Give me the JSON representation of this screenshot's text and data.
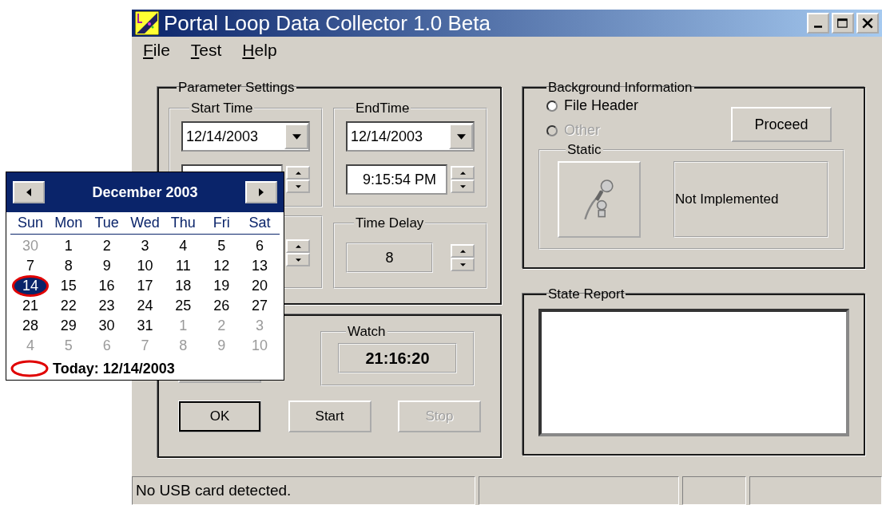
{
  "window": {
    "title": "Portal Loop Data Collector 1.0 Beta"
  },
  "menu": [
    "File",
    "Test",
    "Help"
  ],
  "parameter_settings": {
    "title": "Parameter Settings",
    "start_time": {
      "title": "Start Time",
      "date": "12/14/2003"
    },
    "end_time": {
      "title": "EndTime",
      "date": "12/14/2003",
      "time": "9:15:54 PM"
    },
    "time_delay": {
      "title": "Time Delay",
      "value": "8"
    }
  },
  "watch": {
    "title": "Watch",
    "time": "21:16:20"
  },
  "buttons": [
    {
      "label": "OK",
      "default": true,
      "disabled": false
    },
    {
      "label": "Start",
      "default": false,
      "disabled": false
    },
    {
      "label": "Stop",
      "default": false,
      "disabled": true
    }
  ],
  "background_information": {
    "title": "Background Information",
    "options": [
      {
        "label": "File Header",
        "selected": false,
        "disabled": false
      },
      {
        "label": "Other",
        "selected": false,
        "disabled": true
      }
    ],
    "proceed": "Proceed",
    "static": {
      "title": "Static",
      "text": "Not Implemented"
    }
  },
  "state_report": {
    "title": "State Report"
  },
  "status_bar": [
    "No USB card detected."
  ],
  "calendar": {
    "month": "December 2003",
    "weekdays": [
      "Sun",
      "Mon",
      "Tue",
      "Wed",
      "Thu",
      "Fri",
      "Sat"
    ],
    "weeks": [
      [
        {
          "d": "30",
          "other": true,
          "selected": false,
          "today": false
        },
        {
          "d": "1",
          "other": false,
          "selected": false,
          "today": false
        },
        {
          "d": "2",
          "other": false,
          "selected": false,
          "today": false
        },
        {
          "d": "3",
          "other": false,
          "selected": false,
          "today": false
        },
        {
          "d": "4",
          "other": false,
          "selected": false,
          "today": false
        },
        {
          "d": "5",
          "other": false,
          "selected": false,
          "today": false
        },
        {
          "d": "6",
          "other": false,
          "selected": false,
          "today": false
        }
      ],
      [
        {
          "d": "7",
          "other": false,
          "selected": false,
          "today": false
        },
        {
          "d": "8",
          "other": false,
          "selected": false,
          "today": false
        },
        {
          "d": "9",
          "other": false,
          "selected": false,
          "today": false
        },
        {
          "d": "10",
          "other": false,
          "selected": false,
          "today": false
        },
        {
          "d": "11",
          "other": false,
          "selected": false,
          "today": false
        },
        {
          "d": "12",
          "other": false,
          "selected": false,
          "today": false
        },
        {
          "d": "13",
          "other": false,
          "selected": false,
          "today": false
        }
      ],
      [
        {
          "d": "14",
          "other": false,
          "selected": true,
          "today": true
        },
        {
          "d": "15",
          "other": false,
          "selected": false,
          "today": false
        },
        {
          "d": "16",
          "other": false,
          "selected": false,
          "today": false
        },
        {
          "d": "17",
          "other": false,
          "selected": false,
          "today": false
        },
        {
          "d": "18",
          "other": false,
          "selected": false,
          "today": false
        },
        {
          "d": "19",
          "other": false,
          "selected": false,
          "today": false
        },
        {
          "d": "20",
          "other": false,
          "selected": false,
          "today": false
        }
      ],
      [
        {
          "d": "21",
          "other": false,
          "selected": false,
          "today": false
        },
        {
          "d": "22",
          "other": false,
          "selected": false,
          "today": false
        },
        {
          "d": "23",
          "other": false,
          "selected": false,
          "today": false
        },
        {
          "d": "24",
          "other": false,
          "selected": false,
          "today": false
        },
        {
          "d": "25",
          "other": false,
          "selected": false,
          "today": false
        },
        {
          "d": "26",
          "other": false,
          "selected": false,
          "today": false
        },
        {
          "d": "27",
          "other": false,
          "selected": false,
          "today": false
        }
      ],
      [
        {
          "d": "28",
          "other": false,
          "selected": false,
          "today": false
        },
        {
          "d": "29",
          "other": false,
          "selected": false,
          "today": false
        },
        {
          "d": "30",
          "other": false,
          "selected": false,
          "today": false
        },
        {
          "d": "31",
          "other": false,
          "selected": false,
          "today": false
        },
        {
          "d": "1",
          "other": true,
          "selected": false,
          "today": false
        },
        {
          "d": "2",
          "other": true,
          "selected": false,
          "today": false
        },
        {
          "d": "3",
          "other": true,
          "selected": false,
          "today": false
        }
      ],
      [
        {
          "d": "4",
          "other": true,
          "selected": false,
          "today": false
        },
        {
          "d": "5",
          "other": true,
          "selected": false,
          "today": false
        },
        {
          "d": "6",
          "other": true,
          "selected": false,
          "today": false
        },
        {
          "d": "7",
          "other": true,
          "selected": false,
          "today": false
        },
        {
          "d": "8",
          "other": true,
          "selected": false,
          "today": false
        },
        {
          "d": "9",
          "other": true,
          "selected": false,
          "today": false
        },
        {
          "d": "10",
          "other": true,
          "selected": false,
          "today": false
        }
      ]
    ],
    "today": "Today: 12/14/2003"
  }
}
